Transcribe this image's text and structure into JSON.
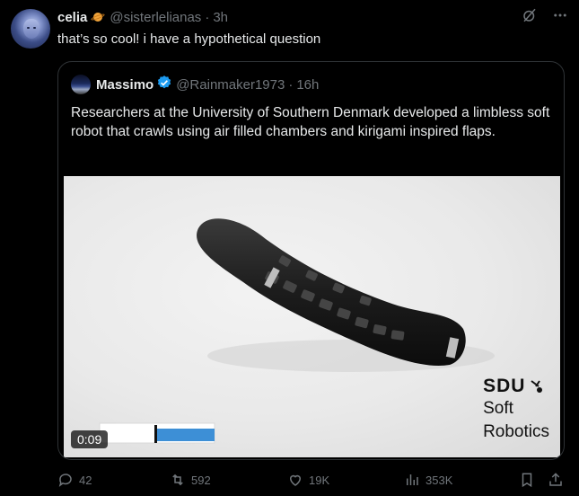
{
  "reply": {
    "author_name": "celia",
    "author_handle": "@sisterlelianas",
    "separator": "·",
    "time": "3h",
    "text": "that’s so cool! i have a hypothetical question"
  },
  "quoted": {
    "author_name": "Massimo",
    "author_handle": "@Rainmaker1973",
    "separator": "·",
    "time": "16h",
    "text": "Researchers at the University of Southern Denmark developed a limbless soft robot that crawls using air filled chambers and kirigami inspired flaps.",
    "video": {
      "duration": "0:09",
      "progress": 0.5,
      "watermark": {
        "brand": "SDU",
        "line1": "Soft",
        "line2": "Robotics"
      }
    }
  },
  "actions": {
    "replies": "42",
    "reposts": "592",
    "likes": "19K",
    "views": "353K"
  },
  "colors": {
    "background": "#000000",
    "text": "#e7e9ea",
    "muted": "#71767b",
    "verified": "#1d9bf0",
    "border": "#2f3336"
  },
  "icons": [
    "grok-icon",
    "more-icon",
    "verified-badge-icon",
    "reply-icon",
    "repost-icon",
    "like-icon",
    "views-icon",
    "bookmark-icon",
    "share-icon"
  ]
}
